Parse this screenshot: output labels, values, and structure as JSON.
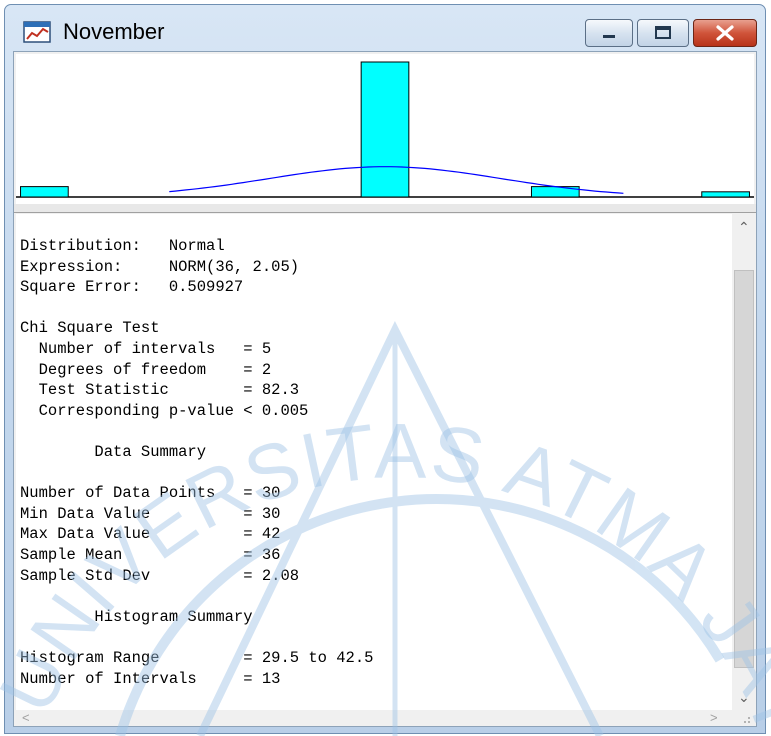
{
  "window": {
    "title": "November"
  },
  "chart_data": {
    "type": "bar",
    "x": [
      30,
      31,
      32,
      33,
      34,
      35,
      36,
      37,
      38,
      39,
      40,
      41,
      42
    ],
    "values": [
      2,
      0,
      0,
      0,
      0,
      0,
      26,
      0,
      0,
      2,
      0,
      0,
      1
    ],
    "series": [
      {
        "name": "",
        "values": [
          2,
          0,
          0,
          0,
          0,
          0,
          26,
          0,
          0,
          2,
          0,
          0,
          1
        ]
      }
    ],
    "overlay": {
      "type": "line",
      "description": "normal density curve NORM(36, 2.05)"
    },
    "ylim": [
      0,
      26
    ],
    "xlim": [
      29.5,
      42.5
    ],
    "bar_color": "#00ffff",
    "curve_color": "#0000ff",
    "grid": false,
    "title": "",
    "xlabel": "",
    "ylabel": ""
  },
  "report": {
    "lines": [
      "Distribution:   Normal",
      "Expression:     NORM(36, 2.05)",
      "Square Error:   0.509927",
      "",
      "Chi Square Test",
      "  Number of intervals   = 5",
      "  Degrees of freedom    = 2",
      "  Test Statistic        = 82.3",
      "  Corresponding p-value < 0.005",
      "",
      "        Data Summary",
      "",
      "Number of Data Points   = 30",
      "Min Data Value          = 30",
      "Max Data Value          = 42",
      "Sample Mean             = 36",
      "Sample Std Dev          = 2.08",
      "",
      "        Histogram Summary",
      "",
      "Histogram Range         = 29.5 to 42.5",
      "Number of Intervals     = 13"
    ]
  },
  "watermark": {
    "text": "UNIVERSITAS ATMA JAYA YOGYAKARTA",
    "color": "#9ec3e6"
  }
}
